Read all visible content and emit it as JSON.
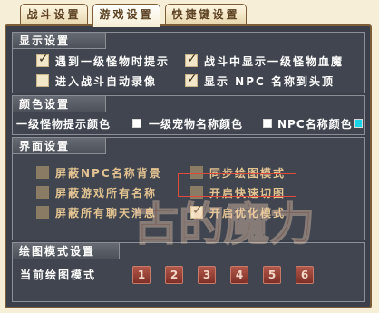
{
  "tabs": [
    {
      "label": "战斗设置"
    },
    {
      "label": "游戏设置"
    },
    {
      "label": "快捷键设置"
    }
  ],
  "display": {
    "title": "显示设置",
    "options": [
      {
        "label": "遇到一级怪物时提示",
        "checked": true
      },
      {
        "label": "战斗中显示一级怪物血魔",
        "checked": true
      },
      {
        "label": "进入战斗自动录像",
        "checked": false
      },
      {
        "label": "显示 NPC 名称到头顶",
        "checked": true
      }
    ]
  },
  "colors": {
    "title": "颜色设置",
    "items": [
      {
        "label": "一级怪物提示颜色",
        "color": "#ffffff"
      },
      {
        "label": "一级宠物名称颜色",
        "color": "#ffffff"
      },
      {
        "label": "NPC名称颜色",
        "color": "#19d3e6"
      }
    ]
  },
  "interface": {
    "title": "界面设置",
    "options": [
      {
        "label": "屏蔽NPC名称背景",
        "checked": false
      },
      {
        "label": "同步绘图模式",
        "checked": false
      },
      {
        "label": "屏蔽游戏所有名称",
        "checked": false
      },
      {
        "label": "开启快速切图",
        "checked": false
      },
      {
        "label": "屏蔽所有聊天消息",
        "checked": false
      },
      {
        "label": "开启优化模式",
        "checked": true
      }
    ]
  },
  "draw_mode": {
    "title": "绘图模式设置",
    "label": "当前绘图模式",
    "buttons": [
      "1",
      "2",
      "3",
      "4",
      "5",
      "6"
    ]
  },
  "watermark": {
    "text": "古的魔力"
  },
  "accent": {
    "border": "#7a5c38",
    "highlight": "#e04a3c",
    "section_bg": "#40454f"
  }
}
